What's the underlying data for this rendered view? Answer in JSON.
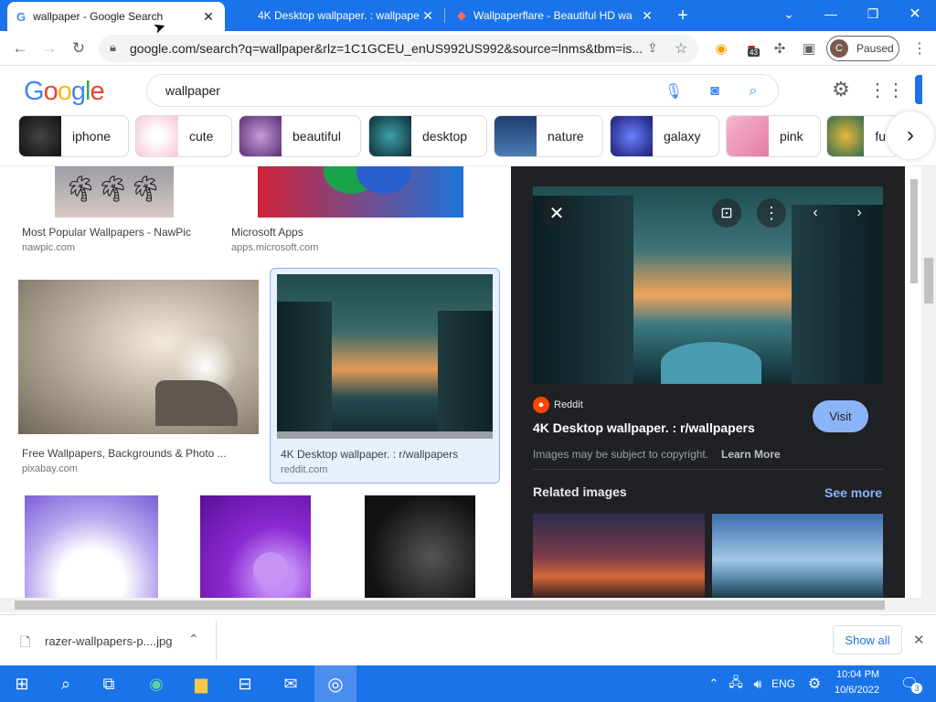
{
  "tabs": [
    {
      "title": "wallpaper - Google Search",
      "active": true
    },
    {
      "title": "4K Desktop wallpaper. : wallpape",
      "active": false
    },
    {
      "title": "Wallpaperflare - Beautiful HD wa",
      "active": false
    }
  ],
  "toolbar": {
    "url": "google.com/search?q=wallpaper&rlz=1C1GCEU_enUS992US992&source=lnms&tbm=is...",
    "profile_initial": "C",
    "profile_label": "Paused",
    "ext_badge": "43"
  },
  "google": {
    "logo": "Google",
    "query": "wallpaper"
  },
  "chips": [
    "iphone",
    "cute",
    "beautiful",
    "desktop",
    "nature",
    "galaxy",
    "pink",
    "fu"
  ],
  "results": [
    {
      "caption": "Most Popular Wallpapers - NawPic",
      "source": "nawpic.com"
    },
    {
      "caption": "Microsoft Apps",
      "source": "apps.microsoft.com"
    },
    {
      "caption": "Free Wallpapers, Backgrounds & Photo ...",
      "source": "pixabay.com"
    },
    {
      "caption": "4K Desktop wallpaper. : r/wallpapers",
      "source": "reddit.com"
    }
  ],
  "panel": {
    "site": "Reddit",
    "title": "4K Desktop wallpaper. : r/wallpapers",
    "visit": "Visit",
    "copyright": "Images may be subject to copyright.",
    "learn_more": "Learn More",
    "related": "Related images",
    "see_more": "See more"
  },
  "downloads": {
    "file": "razer-wallpapers-p....jpg",
    "show_all": "Show all"
  },
  "taskbar": {
    "lang": "ENG",
    "time": "10:04 PM",
    "date": "10/6/2022",
    "notif": "3"
  },
  "colors": {
    "chrome_blue": "#1a73e8",
    "link_blue": "#8ab4f8",
    "panel_bg": "#202124"
  }
}
